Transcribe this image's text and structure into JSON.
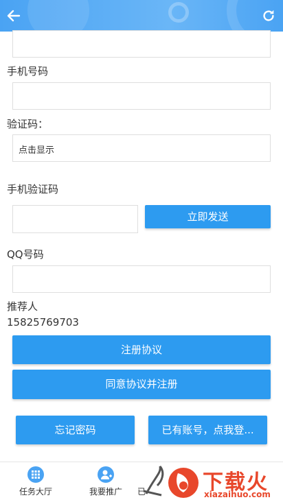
{
  "header": {
    "back_icon": "arrow-left-icon",
    "refresh_icon": "refresh-icon"
  },
  "form": {
    "phone_label": "手机号码",
    "captcha_label": "验证码：",
    "captcha_text": "点击显示",
    "sms_code_label": "手机验证码",
    "send_button": "立即发送",
    "qq_label": "QQ号码",
    "referrer_label": "推荐人",
    "referrer_value": "15825769703"
  },
  "buttons": {
    "agreement": "注册协议",
    "agree_register": "同意协议并注册",
    "forgot_password": "忘记密码",
    "have_account": "已有账号，点我登..."
  },
  "tabbar": {
    "items": [
      {
        "label": "任务大厅",
        "icon": "grid-icon"
      },
      {
        "label": "我要推广",
        "icon": "user-add-icon"
      },
      {
        "label": "已",
        "icon": ""
      }
    ]
  },
  "watermark": {
    "text": "下载火",
    "url_text": "xiazaihuo.com"
  },
  "colors": {
    "accent": "#2d9bf0",
    "header": "#4aa3f3",
    "watermark": "#e8472b"
  }
}
